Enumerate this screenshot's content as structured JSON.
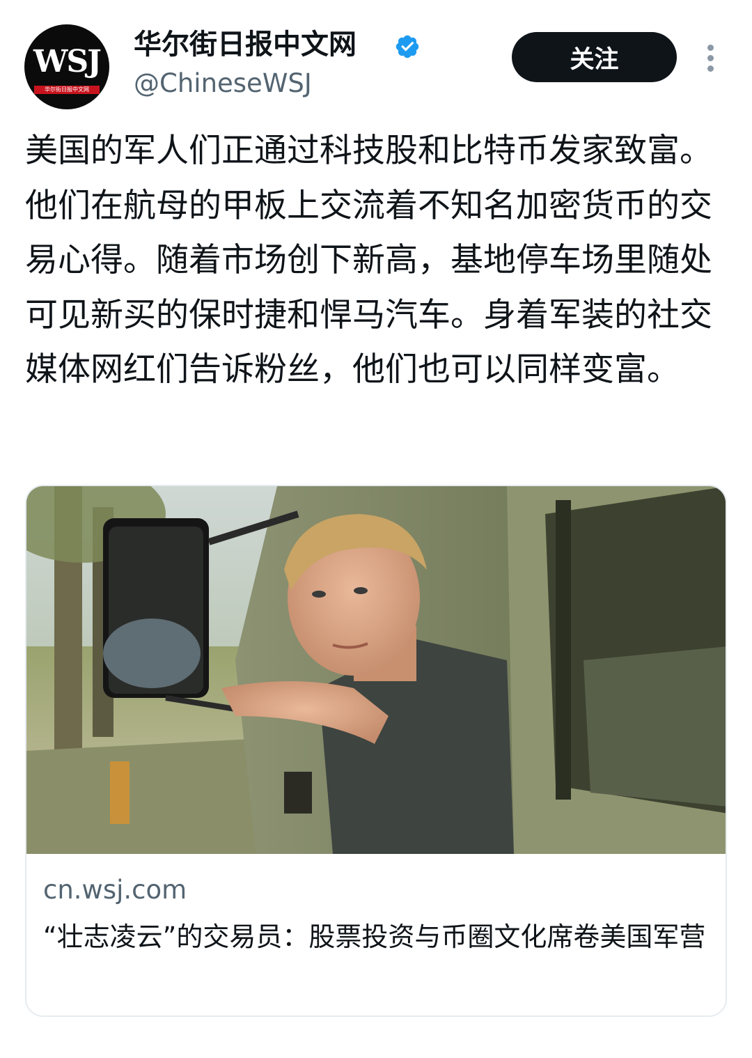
{
  "account": {
    "avatar_text": "WSJ",
    "avatar_band_text": "华尔街日报中文网",
    "display_name": "华尔街日报中文网",
    "verified": true,
    "handle": "@ChineseWSJ"
  },
  "actions": {
    "follow_label": "关注",
    "more_icon": "more-vertical-icon"
  },
  "tweet": {
    "text": "美国的军人们正通过科技股和比特币发家致富。他们在航母的甲板上交流着不知名加密货币的交易心得。随着市场创下新高，基地停车场里随处可见新买的保时捷和悍马汽车。身着军装的社交媒体网红们告诉粉丝，他们也可以同样变富。"
  },
  "link_card": {
    "domain": "cn.wsj.com",
    "title": "“壮志凌云”的交易员：股票投资与币圈文化席卷美国军营"
  },
  "colors": {
    "text_primary": "#0f1419",
    "text_secondary": "#536471",
    "follow_button_bg": "#0f1419",
    "verified_blue": "#1d9bf0",
    "avatar_bg": "#0b0b0b",
    "avatar_band": "#c8141e",
    "card_border": "#e6ecf0"
  }
}
